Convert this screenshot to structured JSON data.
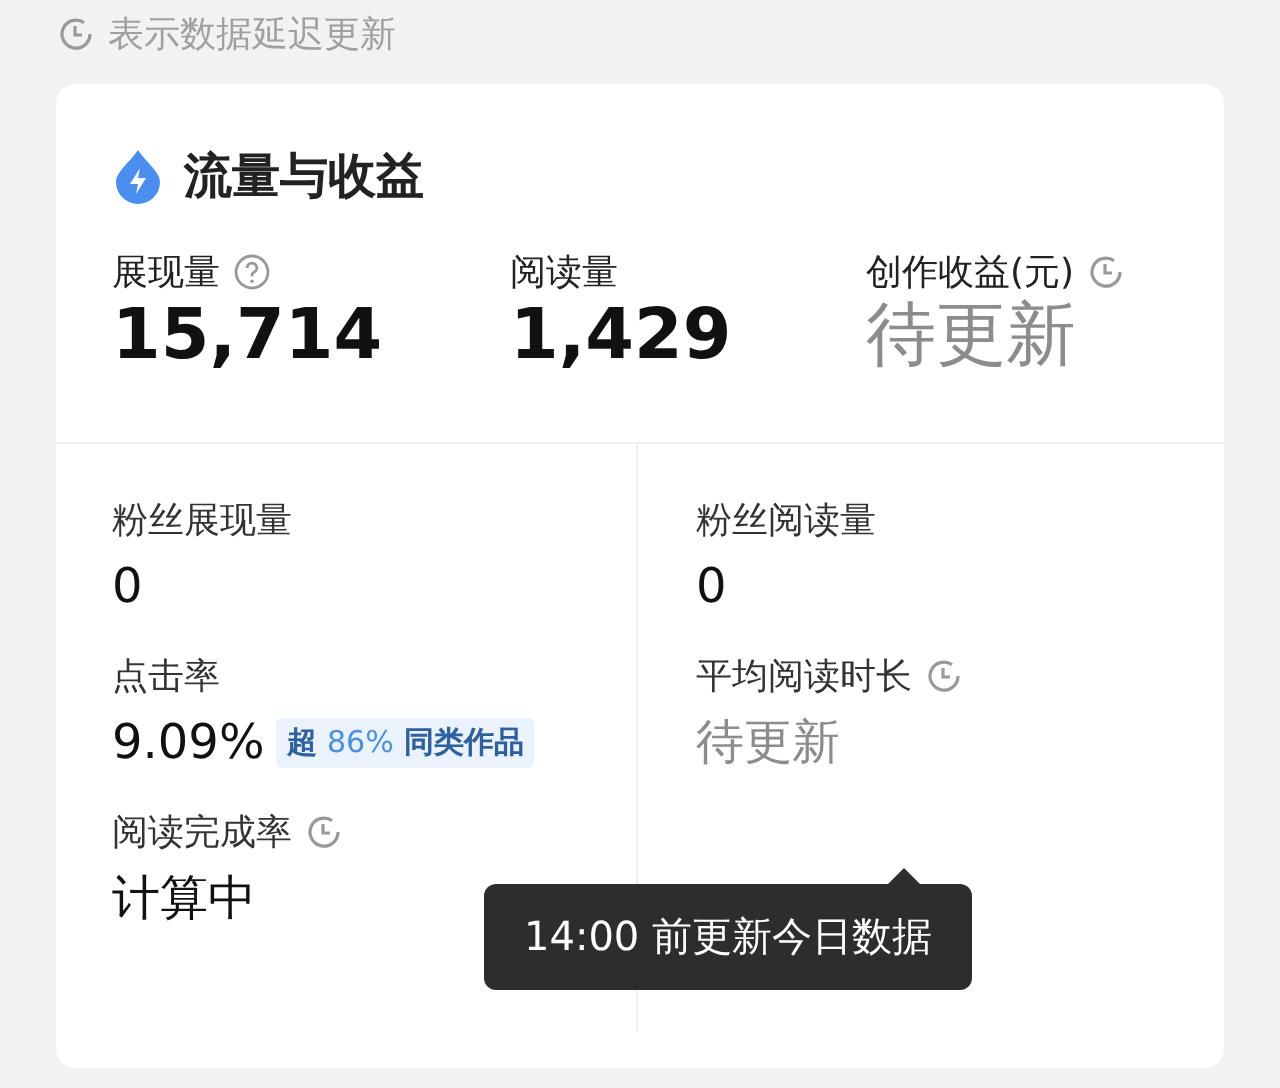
{
  "notice": {
    "text": "表示数据延迟更新"
  },
  "card": {
    "title": "流量与收益",
    "top_metrics": [
      {
        "label": "展现量",
        "has_help": true,
        "value": "15,714",
        "pending": false
      },
      {
        "label": "阅读量",
        "value": "1,429",
        "pending": false
      },
      {
        "label": "创作收益(元)",
        "delayed": true,
        "value": "待更新",
        "pending": true
      }
    ],
    "detail_metrics": [
      {
        "label": "粉丝展现量",
        "value": "0",
        "pending": false
      },
      {
        "label": "粉丝阅读量",
        "value": "0",
        "pending": false
      },
      {
        "label": "点击率",
        "value": "9.09%",
        "pending": false,
        "badge": {
          "prefix": "超",
          "highlight": "86%",
          "suffix": "同类作品"
        }
      },
      {
        "label": "平均阅读时长",
        "delayed": true,
        "value": "待更新",
        "pending": true,
        "tooltip": "14:00 前更新今日数据"
      },
      {
        "label": "阅读完成率",
        "delayed": true,
        "value": "计算中",
        "pending": false
      }
    ]
  }
}
